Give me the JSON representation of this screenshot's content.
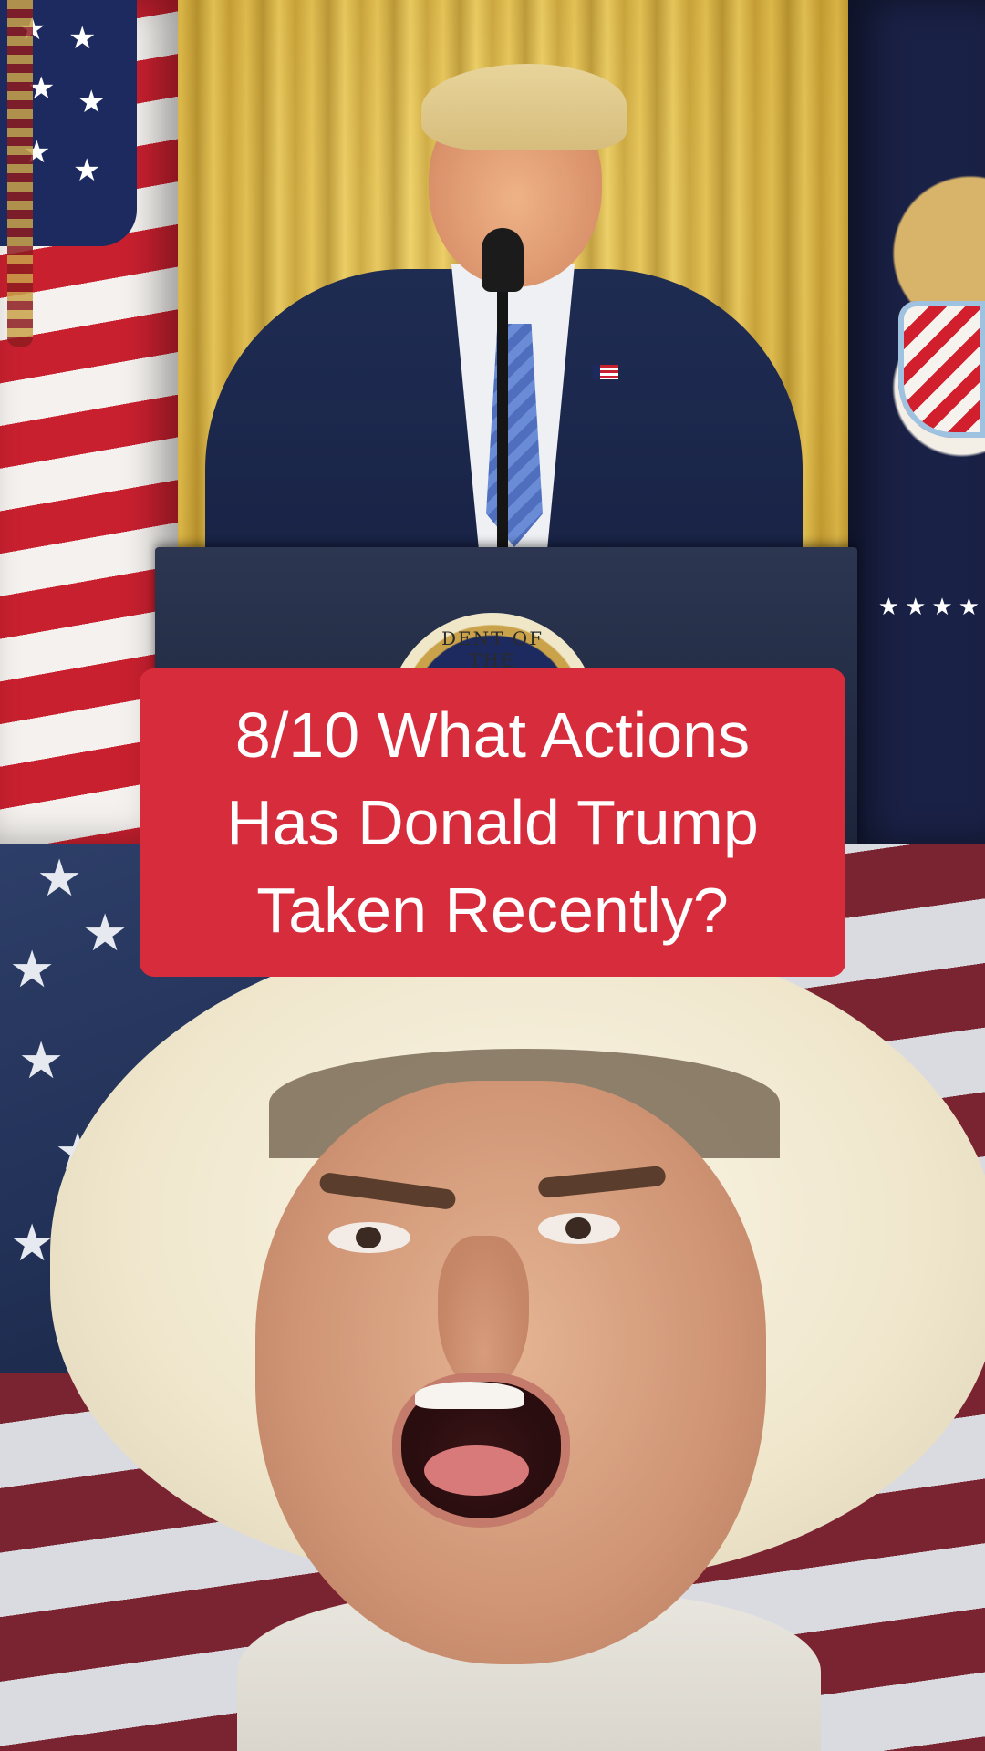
{
  "caption": {
    "lines": [
      "8/10 What Actions",
      "Has Donald Trump",
      "Taken Recently?"
    ],
    "background_color": "#d72c3c",
    "text_color": "#ffffff"
  },
  "top_scene": {
    "podium_seal_text": "DENT OF THE"
  }
}
